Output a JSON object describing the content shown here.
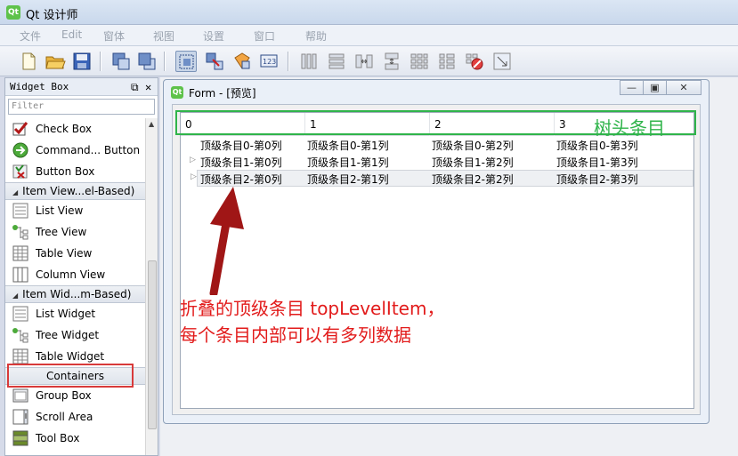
{
  "app": {
    "logo": "Qt",
    "title": "Qt 设计师"
  },
  "menu": [
    "文件",
    "Edit",
    "窗体",
    "视图",
    "设置",
    "窗口",
    "帮助"
  ],
  "toolbar": {
    "icons": [
      "new-file-icon",
      "open-folder-icon",
      "save-icon",
      "send-to-back-icon",
      "bring-to-front-icon",
      "edit-widgets-icon",
      "edit-signals-slots-icon",
      "edit-buddies-icon",
      "edit-tab-order-icon",
      "layout-horizontal-icon",
      "layout-vertical-icon",
      "layout-horizontal-splitter-icon",
      "layout-vertical-splitter-icon",
      "layout-grid-icon",
      "layout-form-icon",
      "break-layout-icon",
      "adjust-size-icon"
    ]
  },
  "widget_box": {
    "title": "Widget Box",
    "filter_placeholder": "Filter",
    "items": [
      {
        "type": "item",
        "label": "Check Box",
        "icon": "check-box-icon"
      },
      {
        "type": "item",
        "label": "Command... Button",
        "icon": "command-link-icon"
      },
      {
        "type": "item",
        "label": "Button Box",
        "icon": "button-box-icon"
      },
      {
        "type": "category",
        "label": "Item View...el-Based)"
      },
      {
        "type": "item",
        "label": "List View",
        "icon": "list-view-icon"
      },
      {
        "type": "item",
        "label": "Tree View",
        "icon": "tree-view-icon"
      },
      {
        "type": "item",
        "label": "Table View",
        "icon": "table-view-icon"
      },
      {
        "type": "item",
        "label": "Column View",
        "icon": "column-view-icon"
      },
      {
        "type": "category",
        "label": "Item Wid...m-Based)"
      },
      {
        "type": "item",
        "label": "List Widget",
        "icon": "list-widget-icon"
      },
      {
        "type": "item",
        "label": "Tree Widget",
        "icon": "tree-widget-icon"
      },
      {
        "type": "item",
        "label": "Table Widget",
        "icon": "table-widget-icon"
      },
      {
        "type": "category",
        "label": "Containers"
      },
      {
        "type": "item",
        "label": "Group Box",
        "icon": "group-box-icon"
      },
      {
        "type": "item",
        "label": "Scroll Area",
        "icon": "scroll-area-icon"
      },
      {
        "type": "item",
        "label": "Tool Box",
        "icon": "tool-box-icon"
      }
    ]
  },
  "form": {
    "logo": "Qt",
    "caption": "Form - [预览]",
    "tree": {
      "headers": [
        "0",
        "1",
        "2",
        "3"
      ],
      "rows": [
        {
          "expandable": false,
          "selected": false,
          "cells": [
            "顶级条目0-第0列",
            "顶级条目0-第1列",
            "顶级条目0-第2列",
            "顶级条目0-第3列"
          ]
        },
        {
          "expandable": true,
          "selected": false,
          "cells": [
            "顶级条目1-第0列",
            "顶级条目1-第1列",
            "顶级条目1-第2列",
            "顶级条目1-第3列"
          ]
        },
        {
          "expandable": true,
          "selected": true,
          "cells": [
            "顶级条目2-第0列",
            "顶级条目2-第1列",
            "顶级条目2-第2列",
            "顶级条目2-第3列"
          ]
        }
      ]
    }
  },
  "annotations": {
    "header_label": "树头条目",
    "note_line1": "折叠的顶级条目 topLevelItem，",
    "note_line2": "每个条目内部可以有多列数据"
  },
  "colors": {
    "annotation_red": "#e21b1b",
    "annotation_green": "#2fb44a",
    "highlight_red": "#d83a3a"
  }
}
